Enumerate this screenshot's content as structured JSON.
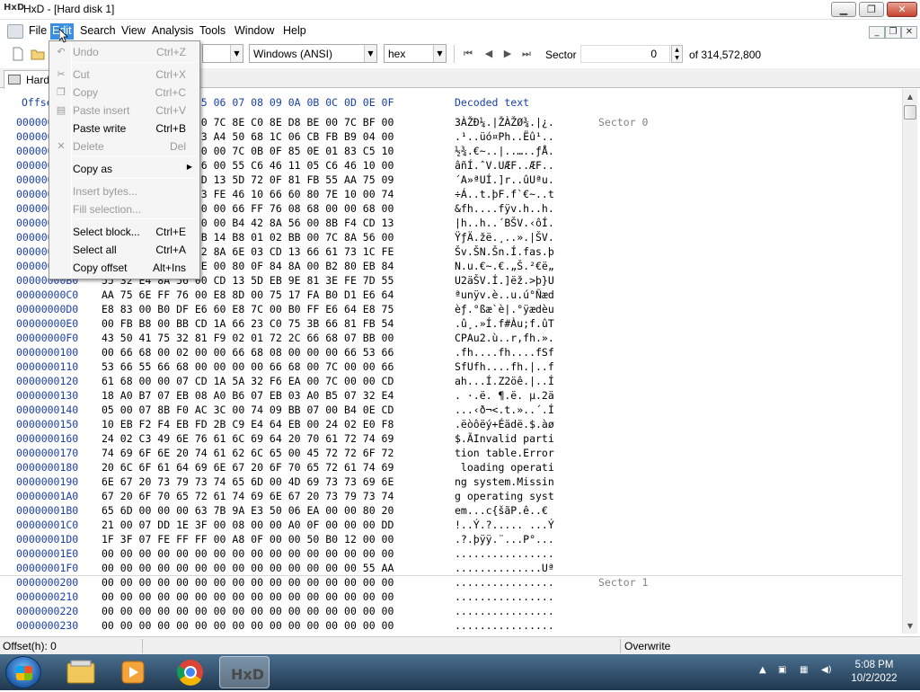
{
  "window": {
    "title": "HxD - [Hard disk 1]"
  },
  "menubar": {
    "items": [
      "File",
      "Edit",
      "Search",
      "View",
      "Analysis",
      "Tools",
      "Window",
      "Help"
    ],
    "active": "Edit"
  },
  "toolbar": {
    "charset": "Windows (ANSI)",
    "display_mode": "hex",
    "sector_label": "Sector",
    "sector_value": "0",
    "sector_total": "of 314,572,800"
  },
  "tab": {
    "label": "Hard disk 1"
  },
  "edit_menu": {
    "items": [
      {
        "label": "Undo",
        "shortcut": "Ctrl+Z",
        "enabled": false,
        "icon": "undo-icon"
      },
      {
        "label": "Cut",
        "shortcut": "Ctrl+X",
        "enabled": false,
        "icon": "cut-icon"
      },
      {
        "label": "Copy",
        "shortcut": "Ctrl+C",
        "enabled": false,
        "icon": "copy-icon"
      },
      {
        "label": "Paste insert",
        "shortcut": "Ctrl+V",
        "enabled": false,
        "icon": "paste-icon"
      },
      {
        "label": "Paste write",
        "shortcut": "Ctrl+B",
        "enabled": true,
        "icon": ""
      },
      {
        "label": "Delete",
        "shortcut": "Del",
        "enabled": false,
        "icon": "delete-icon"
      },
      {
        "label": "Copy as",
        "shortcut": "",
        "enabled": true,
        "submenu": true
      },
      {
        "label": "Insert bytes...",
        "shortcut": "",
        "enabled": false
      },
      {
        "label": "Fill selection...",
        "shortcut": "",
        "enabled": false
      },
      {
        "label": "Select block...",
        "shortcut": "Ctrl+E",
        "enabled": true
      },
      {
        "label": "Select all",
        "shortcut": "Ctrl+A",
        "enabled": true
      },
      {
        "label": "Copy offset",
        "shortcut": "Alt+Ins",
        "enabled": true
      }
    ]
  },
  "editor": {
    "header": {
      "offset": "Offset(h)",
      "columns": "00 01 02 03 04 05 06 07 08 09 0A 0B 0C 0D 0E 0F",
      "decoded": "Decoded text"
    },
    "rows": [
      {
        "offset": "0000000000",
        "hex": "33 C0 8E D0 BC 00 7C 8E C0 8E D8 BE 00 7C BF 00",
        "text": "3ÀŽÐ¼.|ŽÀŽØ¾.|¿.",
        "sector": "Sector 0"
      },
      {
        "offset": "0000000010",
        "hex": "06 B9 00 02 FC F3 A4 50 68 1C 06 CB FB B9 04 00",
        "text": ".¹..üó¤Ph..Ëû¹..",
        "sector": ""
      },
      {
        "offset": "0000000020",
        "hex": "BD BE 07 80 7E 00 00 7C 0B 0F 85 0E 01 83 C5 10",
        "text": "½¾.€~..|..…..ƒÅ.",
        "sector": ""
      },
      {
        "offset": "0000000030",
        "hex": "E2 F1 CD 18 88 56 00 55 C6 46 11 05 C6 46 10 00",
        "text": "âñÍ.ˆV.UÆF..ÆF..",
        "sector": ""
      },
      {
        "offset": "0000000040",
        "hex": "B4 41 BB AA 55 CD 13 5D 72 0F 81 FB 55 AA 75 09",
        "text": "´A»ªUÍ.]r..ûUªu.",
        "sector": ""
      },
      {
        "offset": "0000000050",
        "hex": "F7 C1 01 00 74 03 FE 46 10 66 60 80 7E 10 00 74",
        "text": "÷Á..t.þF.f`€~..t",
        "sector": ""
      },
      {
        "offset": "0000000060",
        "hex": "26 66 68 00 00 00 00 66 FF 76 08 68 00 00 68 00",
        "text": "&fh....fÿv.h..h.",
        "sector": ""
      },
      {
        "offset": "0000000070",
        "hex": "7C 68 01 00 68 10 00 B4 42 8A 56 00 8B F4 CD 13",
        "text": "|h..h..´BŠV.‹ôÍ.",
        "sector": ""
      },
      {
        "offset": "0000000080",
        "hex": "9F 83 C4 10 9E EB 14 B8 01 02 BB 00 7C 8A 56 00",
        "text": "ŸƒÄ.žë.¸..».|ŠV.",
        "sector": ""
      },
      {
        "offset": "0000000090",
        "hex": "8A 76 01 8A 4E 02 8A 6E 03 CD 13 66 61 73 1C FE",
        "text": "Šv.ŠN.Šn.Í.fas.þ",
        "sector": ""
      },
      {
        "offset": "00000000A0",
        "hex": "4E 11 75 0C 80 7E 00 80 0F 84 8A 00 B2 80 EB 84",
        "text": "N.u.€~.€.„Š.²€ë„",
        "sector": ""
      },
      {
        "offset": "00000000B0",
        "hex": "55 32 E4 8A 56 00 CD 13 5D EB 9E 81 3E FE 7D 55",
        "text": "U2äŠV.Í.]ëž.>þ}U",
        "sector": ""
      },
      {
        "offset": "00000000C0",
        "hex": "AA 75 6E FF 76 00 E8 8D 00 75 17 FA B0 D1 E6 64",
        "text": "ªunÿv.è..u.ú°Ñæd",
        "sector": ""
      },
      {
        "offset": "00000000D0",
        "hex": "E8 83 00 B0 DF E6 60 E8 7C 00 B0 FF E6 64 E8 75",
        "text": "èƒ.°ßæ`è|.°ÿædèu",
        "sector": ""
      },
      {
        "offset": "00000000E0",
        "hex": "00 FB B8 00 BB CD 1A 66 23 C0 75 3B 66 81 FB 54",
        "text": ".û¸.»Í.f#Àu;f.ûT",
        "sector": ""
      },
      {
        "offset": "00000000F0",
        "hex": "43 50 41 75 32 81 F9 02 01 72 2C 66 68 07 BB 00",
        "text": "CPAu2.ù..r,fh.».",
        "sector": ""
      },
      {
        "offset": "0000000100",
        "hex": "00 66 68 00 02 00 00 66 68 08 00 00 00 66 53 66",
        "text": ".fh....fh....fSf",
        "sector": ""
      },
      {
        "offset": "0000000110",
        "hex": "53 66 55 66 68 00 00 00 00 66 68 00 7C 00 00 66",
        "text": "SfUfh....fh.|..f",
        "sector": ""
      },
      {
        "offset": "0000000120",
        "hex": "61 68 00 00 07 CD 1A 5A 32 F6 EA 00 7C 00 00 CD",
        "text": "ah...Í.Z2öê.|..Í",
        "sector": ""
      },
      {
        "offset": "0000000130",
        "hex": "18 A0 B7 07 EB 08 A0 B6 07 EB 03 A0 B5 07 32 E4",
        "text": ". ·.ë. ¶.ë. µ.2ä",
        "sector": ""
      },
      {
        "offset": "0000000140",
        "hex": "05 00 07 8B F0 AC 3C 00 74 09 BB 07 00 B4 0E CD",
        "text": "...‹ð¬<.t.»..´.Í",
        "sector": ""
      },
      {
        "offset": "0000000150",
        "hex": "10 EB F2 F4 EB FD 2B C9 E4 64 EB 00 24 02 E0 F8",
        "text": ".ëòôëý+Éädë.$.àø",
        "sector": ""
      },
      {
        "offset": "0000000160",
        "hex": "24 02 C3 49 6E 76 61 6C 69 64 20 70 61 72 74 69",
        "text": "$.ÃInvalid parti",
        "sector": ""
      },
      {
        "offset": "0000000170",
        "hex": "74 69 6F 6E 20 74 61 62 6C 65 00 45 72 72 6F 72",
        "text": "tion table.Error",
        "sector": ""
      },
      {
        "offset": "0000000180",
        "hex": "20 6C 6F 61 64 69 6E 67 20 6F 70 65 72 61 74 69",
        "text": " loading operati",
        "sector": ""
      },
      {
        "offset": "0000000190",
        "hex": "6E 67 20 73 79 73 74 65 6D 00 4D 69 73 73 69 6E",
        "text": "ng system.Missin",
        "sector": ""
      },
      {
        "offset": "00000001A0",
        "hex": "67 20 6F 70 65 72 61 74 69 6E 67 20 73 79 73 74",
        "text": "g operating syst",
        "sector": ""
      },
      {
        "offset": "00000001B0",
        "hex": "65 6D 00 00 00 63 7B 9A E3 50 06 EA 00 00 80 20",
        "text": "em...c{šãP.ê..€ ",
        "sector": ""
      },
      {
        "offset": "00000001C0",
        "hex": "21 00 07 DD 1E 3F 00 08 00 00 A0 0F 00 00 00 DD",
        "text": "!..Ý.?..... ...Ý",
        "sector": ""
      },
      {
        "offset": "00000001D0",
        "hex": "1F 3F 07 FE FF FF 00 A8 0F 00 00 50 B0 12 00 00",
        "text": ".?.þÿÿ.¨...P°...",
        "sector": ""
      },
      {
        "offset": "00000001E0",
        "hex": "00 00 00 00 00 00 00 00 00 00 00 00 00 00 00 00",
        "text": "................",
        "sector": ""
      },
      {
        "offset": "00000001F0",
        "hex": "00 00 00 00 00 00 00 00 00 00 00 00 00 00 55 AA",
        "text": "..............Uª",
        "sector": ""
      },
      {
        "offset": "0000000200",
        "hex": "00 00 00 00 00 00 00 00 00 00 00 00 00 00 00 00",
        "text": "................",
        "sector": "Sector 1"
      },
      {
        "offset": "0000000210",
        "hex": "00 00 00 00 00 00 00 00 00 00 00 00 00 00 00 00",
        "text": "................",
        "sector": ""
      },
      {
        "offset": "0000000220",
        "hex": "00 00 00 00 00 00 00 00 00 00 00 00 00 00 00 00",
        "text": "................",
        "sector": ""
      },
      {
        "offset": "0000000230",
        "hex": "00 00 00 00 00 00 00 00 00 00 00 00 00 00 00 00",
        "text": "................",
        "sector": ""
      }
    ]
  },
  "statusbar": {
    "offset": "Offset(h): 0",
    "mode": "Overwrite"
  },
  "taskbar": {
    "apps": [
      "explorer-icon",
      "media-player-icon",
      "chrome-icon",
      "hxd-icon"
    ],
    "time": "5:08 PM",
    "date": "10/2/2022"
  }
}
